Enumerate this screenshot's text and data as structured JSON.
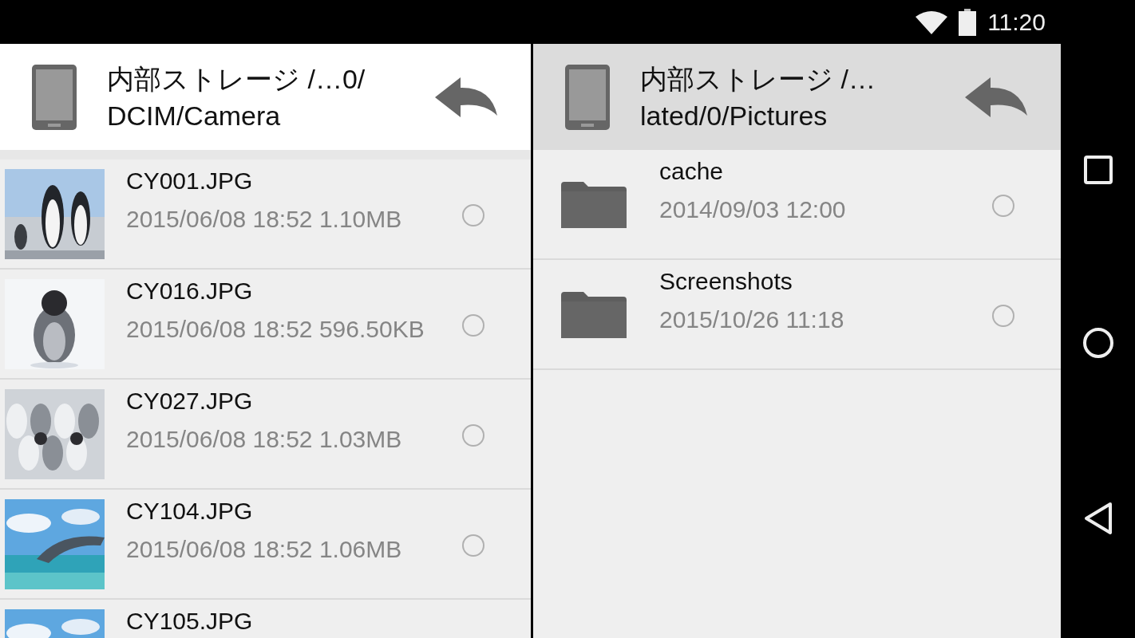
{
  "status_bar": {
    "time": "11:20"
  },
  "panes": [
    {
      "active": true,
      "path_line_1": "内部ストレージ /…0/",
      "path_line_2": "DCIM/Camera",
      "items": [
        {
          "name": "CY001.JPG",
          "details": "2015/06/08 18:52 1.10MB",
          "selected": false
        },
        {
          "name": "CY016.JPG",
          "details": "2015/06/08 18:52 596.50KB",
          "selected": false
        },
        {
          "name": "CY027.JPG",
          "details": "2015/06/08 18:52 1.03MB",
          "selected": false
        },
        {
          "name": "CY104.JPG",
          "details": "2015/06/08 18:52 1.06MB",
          "selected": false
        },
        {
          "name": "CY105.JPG"
        }
      ]
    },
    {
      "active": false,
      "path_line_1": "内部ストレージ /…",
      "path_line_2": "lated/0/Pictures",
      "items": [
        {
          "kind": "folder",
          "name": "cache",
          "details": "2014/09/03 12:00",
          "selected": false
        },
        {
          "kind": "folder",
          "name": "Screenshots",
          "details": "2015/10/26 11:18",
          "selected": false
        }
      ]
    }
  ]
}
